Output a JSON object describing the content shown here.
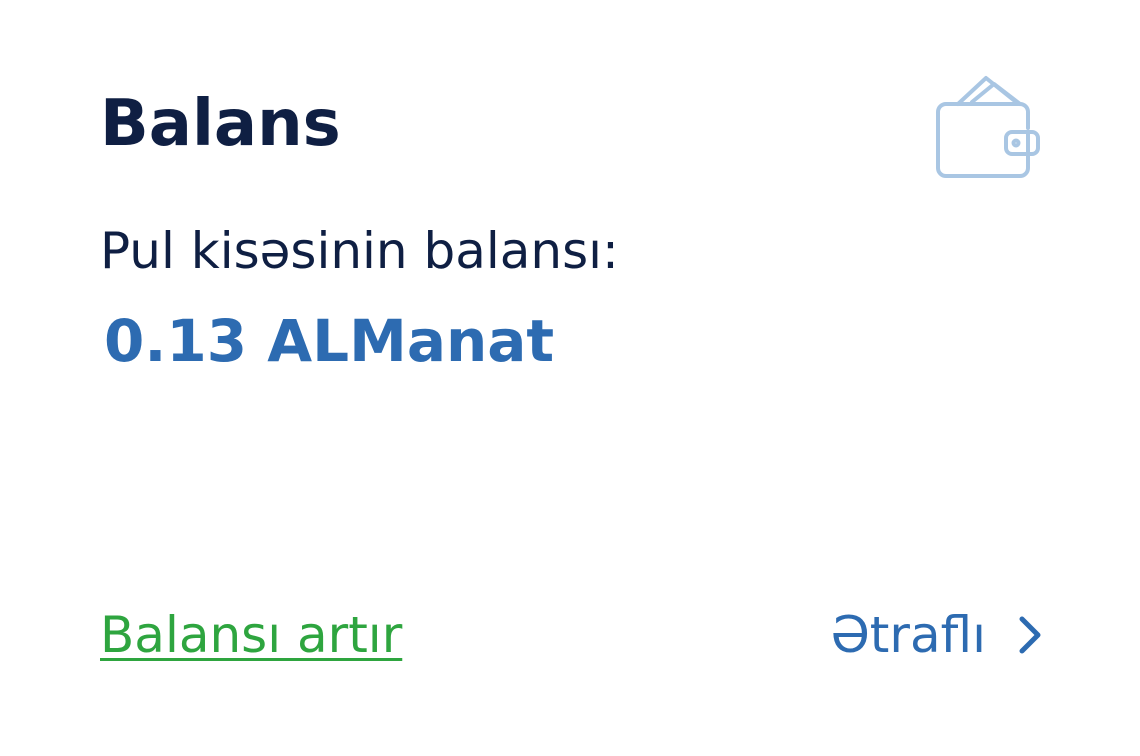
{
  "card": {
    "title": "Balans",
    "wallet_label": "Pul kisəsinin balansı:",
    "wallet_amount": "0.13 ALManat",
    "topup_link": "Balansı artır",
    "more_link": "Ətraflı"
  },
  "icons": {
    "wallet": "wallet-icon",
    "more": "chevron-right-icon"
  },
  "colors": {
    "title": "#0f1f43",
    "amount": "#2d6bb1",
    "topup": "#2ea53f",
    "wallet_icon": "#a9c6e3"
  }
}
